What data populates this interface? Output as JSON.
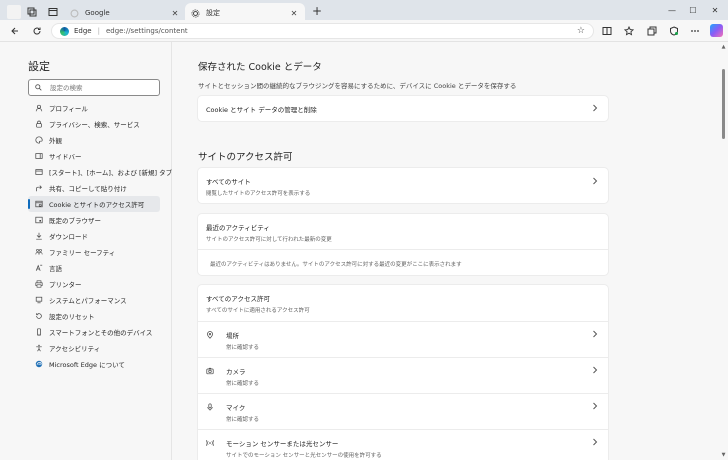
{
  "tabs": [
    {
      "title": "Google",
      "active": false
    },
    {
      "title": "設定",
      "active": true
    }
  ],
  "address": {
    "brand": "Edge",
    "url": "edge://settings/content"
  },
  "sidebar": {
    "title": "設定",
    "search_placeholder": "設定の検索",
    "items": [
      {
        "label": "プロフィール",
        "icon": "profile-icon"
      },
      {
        "label": "プライバシー、検索、サービス",
        "icon": "lock-icon"
      },
      {
        "label": "外観",
        "icon": "appearance-icon"
      },
      {
        "label": "サイドバー",
        "icon": "sidebar-icon"
      },
      {
        "label": "[スタート]、[ホーム]、および [新規] タブ",
        "icon": "home-tab-icon"
      },
      {
        "label": "共有、コピーして貼り付け",
        "icon": "share-icon"
      },
      {
        "label": "Cookie とサイトのアクセス許可",
        "icon": "cookie-icon",
        "selected": true
      },
      {
        "label": "既定のブラウザー",
        "icon": "browser-icon"
      },
      {
        "label": "ダウンロード",
        "icon": "download-icon"
      },
      {
        "label": "ファミリー セーフティ",
        "icon": "family-icon"
      },
      {
        "label": "言語",
        "icon": "language-icon"
      },
      {
        "label": "プリンター",
        "icon": "printer-icon"
      },
      {
        "label": "システムとパフォーマンス",
        "icon": "system-icon"
      },
      {
        "label": "設定のリセット",
        "icon": "reset-icon"
      },
      {
        "label": "スマートフォンとその他のデバイス",
        "icon": "phone-icon"
      },
      {
        "label": "アクセシビリティ",
        "icon": "accessibility-icon"
      },
      {
        "label": "Microsoft Edge について",
        "icon": "edge-icon"
      }
    ]
  },
  "main": {
    "cookie_section": {
      "title": "保存された Cookie とデータ",
      "description": "サイトとセッション間の継続的なブラウジングを容易にするために、デバイスに Cookie とデータを保存する",
      "row_label": "Cookie とサイト データの管理と削除"
    },
    "permissions_section": {
      "title": "サイトのアクセス許可",
      "all_sites": {
        "title": "すべてのサイト",
        "subtitle": "閲覧したサイトのアクセス許可を表示する"
      },
      "recent": {
        "title": "最近のアクティビティ",
        "subtitle": "サイトのアクセス許可に対して行われた最新の変更",
        "empty": "最近のアクティビティはありません。サイトのアクセス許可に対する最近の変更がここに表示されます"
      },
      "all_permissions": {
        "title": "すべてのアクセス許可",
        "subtitle": "すべてのサイトに適用されるアクセス許可",
        "items": [
          {
            "title": "場所",
            "subtitle": "常に確認する",
            "icon": "location-icon"
          },
          {
            "title": "カメラ",
            "subtitle": "常に確認する",
            "icon": "camera-icon"
          },
          {
            "title": "マイク",
            "subtitle": "常に確認する",
            "icon": "microphone-icon"
          },
          {
            "title": "モーション センサーまたは光センサー",
            "subtitle": "サイトでのモーション センサーと光センサーの使用を許可する",
            "icon": "motion-sensor-icon"
          }
        ]
      }
    }
  }
}
